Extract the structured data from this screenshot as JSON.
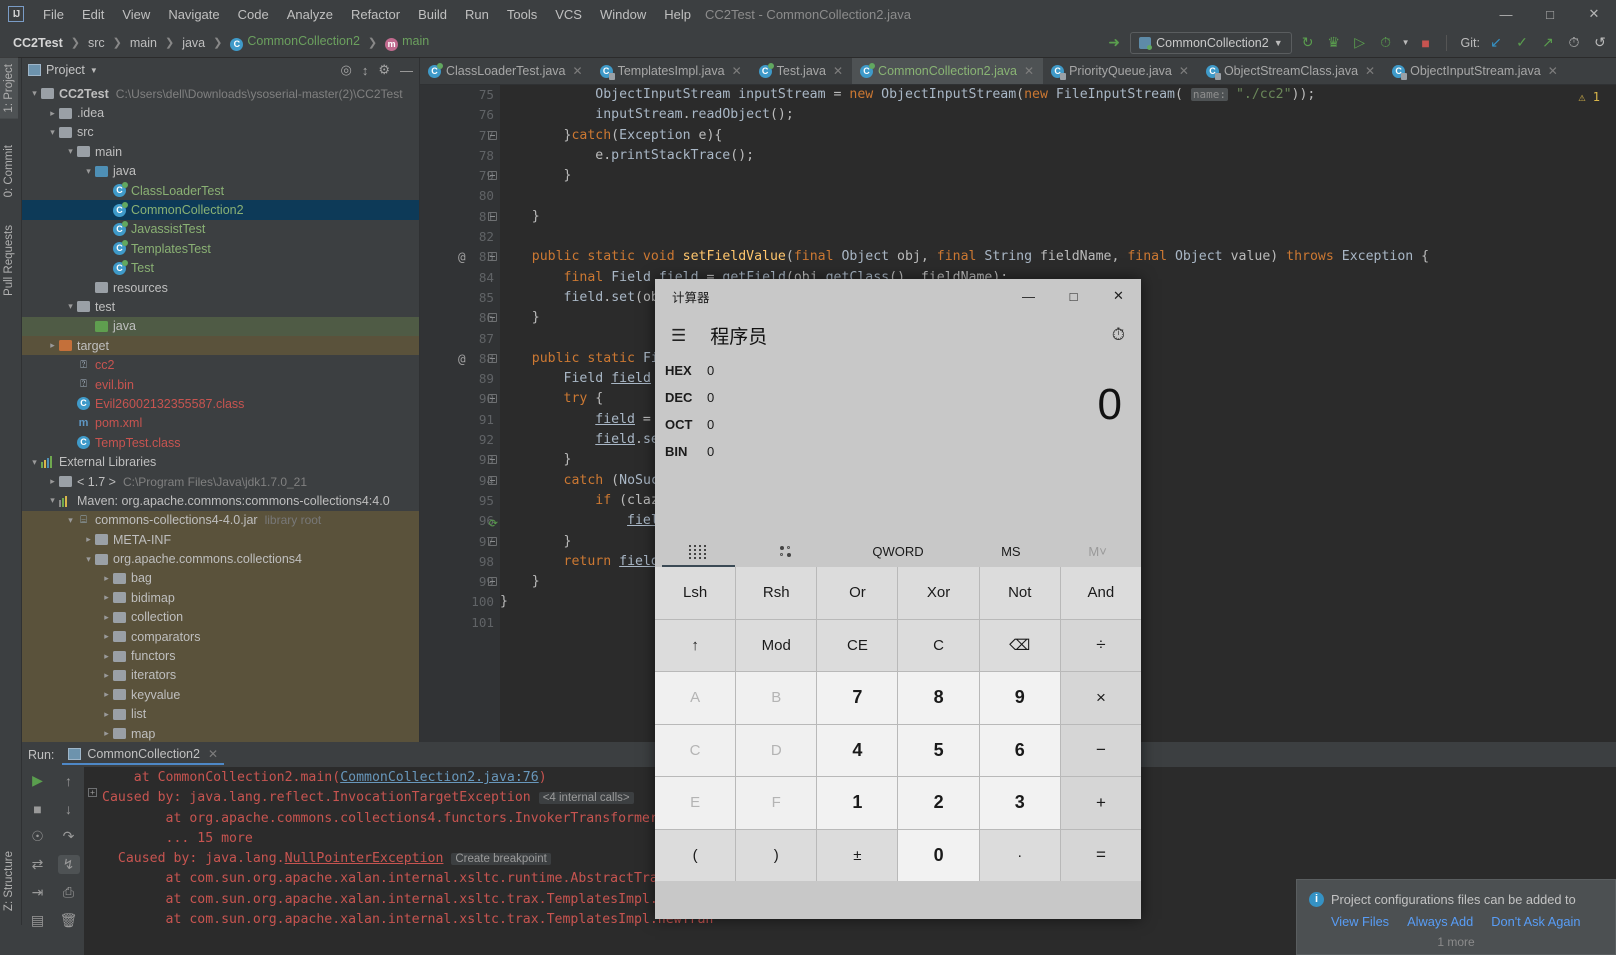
{
  "window": {
    "title": "CC2Test - CommonCollection2.java",
    "controls": [
      "—",
      "□",
      "✕"
    ]
  },
  "menubar": {
    "logo": "IJ",
    "items": [
      "File",
      "Edit",
      "View",
      "Navigate",
      "Code",
      "Analyze",
      "Refactor",
      "Build",
      "Run",
      "Tools",
      "VCS",
      "Window",
      "Help"
    ]
  },
  "breadcrumb": {
    "items": [
      {
        "label": "CC2Test",
        "style": "bold"
      },
      {
        "label": "src",
        "style": "plain"
      },
      {
        "label": "main",
        "style": "plain"
      },
      {
        "label": "java",
        "style": "plain"
      },
      {
        "label": "CommonCollection2",
        "style": "class"
      },
      {
        "label": "main",
        "style": "method"
      }
    ]
  },
  "toolbar": {
    "back_arrow_icon": "back-arrow-icon",
    "run_config": "CommonCollection2",
    "icons": [
      "rerun-icon",
      "debug-icon",
      "run-with-coverage-icon",
      "profiler-icon",
      "stop-icon"
    ],
    "git_label": "Git:",
    "git_icons": [
      "update-project-icon",
      "commit-icon",
      "push-icon",
      "history-icon",
      "rollback-icon"
    ]
  },
  "left_strip": {
    "tabs": [
      "1: Project",
      "0: Commit",
      "Pull Requests"
    ],
    "bottom_tabs": [
      "Z: Structure"
    ]
  },
  "project_panel": {
    "title": "Project",
    "actions": [
      "locate-icon",
      "collapse-all-icon",
      "settings-icon",
      "hide-icon"
    ],
    "tree": [
      {
        "depth": 0,
        "arrow": "down",
        "icon": "module-folder",
        "label": "CC2Test",
        "style": "bold",
        "path": "C:\\Users\\dell\\Downloads\\ysoserial-master(2)\\CC2Test"
      },
      {
        "depth": 1,
        "arrow": "right",
        "icon": "folder-grey",
        "label": ".idea"
      },
      {
        "depth": 1,
        "arrow": "down",
        "icon": "folder-grey",
        "label": "src"
      },
      {
        "depth": 2,
        "arrow": "down",
        "icon": "folder-grey",
        "label": "main"
      },
      {
        "depth": 3,
        "arrow": "down",
        "icon": "folder-blue",
        "label": "java"
      },
      {
        "depth": 4,
        "arrow": "none",
        "icon": "class",
        "label": "ClassLoaderTest",
        "style": "green"
      },
      {
        "depth": 4,
        "arrow": "none",
        "icon": "class",
        "label": "CommonCollection2",
        "style": "green",
        "selected": true
      },
      {
        "depth": 4,
        "arrow": "none",
        "icon": "class",
        "label": "JavassistTest",
        "style": "green"
      },
      {
        "depth": 4,
        "arrow": "none",
        "icon": "class",
        "label": "TemplatesTest",
        "style": "green"
      },
      {
        "depth": 4,
        "arrow": "none",
        "icon": "class",
        "label": "Test",
        "style": "green"
      },
      {
        "depth": 3,
        "arrow": "none",
        "icon": "folder-resources",
        "label": "resources"
      },
      {
        "depth": 2,
        "arrow": "down",
        "icon": "folder-grey",
        "label": "test"
      },
      {
        "depth": 3,
        "arrow": "none",
        "icon": "folder-green",
        "label": "java",
        "highlight": "green"
      },
      {
        "depth": 1,
        "arrow": "right",
        "icon": "folder-orange",
        "label": "target",
        "highlight": "olive"
      },
      {
        "depth": 2,
        "arrow": "none",
        "icon": "file-unknown",
        "label": "cc2",
        "style": "red"
      },
      {
        "depth": 2,
        "arrow": "none",
        "icon": "file-unknown",
        "label": "evil.bin",
        "style": "red"
      },
      {
        "depth": 2,
        "arrow": "none",
        "icon": "class-plain",
        "label": "Evil26002132355587.class",
        "style": "red"
      },
      {
        "depth": 2,
        "arrow": "none",
        "icon": "maven-file",
        "label": "pom.xml",
        "style": "red"
      },
      {
        "depth": 2,
        "arrow": "none",
        "icon": "class-plain",
        "label": "TempTest.class",
        "style": "red"
      },
      {
        "depth": 0,
        "arrow": "down",
        "icon": "libraries",
        "label": "External Libraries"
      },
      {
        "depth": 1,
        "arrow": "right",
        "icon": "jdk",
        "label": "< 1.7 >",
        "path": "C:\\Program Files\\Java\\jdk1.7.0_21"
      },
      {
        "depth": 1,
        "arrow": "down",
        "icon": "maven-lib",
        "label": "Maven: org.apache.commons:commons-collections4:4.0"
      },
      {
        "depth": 2,
        "arrow": "down",
        "icon": "jar",
        "label": "commons-collections4-4.0.jar",
        "hint": "library root",
        "highlight": "olive"
      },
      {
        "depth": 3,
        "arrow": "right",
        "icon": "folder-grey",
        "label": "META-INF",
        "highlight": "olive"
      },
      {
        "depth": 3,
        "arrow": "down",
        "icon": "folder-grey",
        "label": "org.apache.commons.collections4",
        "highlight": "olive"
      },
      {
        "depth": 4,
        "arrow": "right",
        "icon": "folder-grey",
        "label": "bag",
        "highlight": "olive"
      },
      {
        "depth": 4,
        "arrow": "right",
        "icon": "folder-grey",
        "label": "bidimap",
        "highlight": "olive"
      },
      {
        "depth": 4,
        "arrow": "right",
        "icon": "folder-grey",
        "label": "collection",
        "highlight": "olive"
      },
      {
        "depth": 4,
        "arrow": "right",
        "icon": "folder-grey",
        "label": "comparators",
        "highlight": "olive"
      },
      {
        "depth": 4,
        "arrow": "right",
        "icon": "folder-grey",
        "label": "functors",
        "highlight": "olive"
      },
      {
        "depth": 4,
        "arrow": "right",
        "icon": "folder-grey",
        "label": "iterators",
        "highlight": "olive"
      },
      {
        "depth": 4,
        "arrow": "right",
        "icon": "folder-grey",
        "label": "keyvalue",
        "highlight": "olive"
      },
      {
        "depth": 4,
        "arrow": "right",
        "icon": "folder-grey",
        "label": "list",
        "highlight": "olive"
      },
      {
        "depth": 4,
        "arrow": "right",
        "icon": "folder-grey",
        "label": "map",
        "highlight": "olive"
      }
    ]
  },
  "editor_tabs": [
    {
      "label": "ClassLoaderTest.java",
      "icon": "java-class-icon",
      "active": false
    },
    {
      "label": "TemplatesImpl.java",
      "icon": "java-class-locked-icon",
      "active": false
    },
    {
      "label": "Test.java",
      "icon": "java-class-icon",
      "active": false
    },
    {
      "label": "CommonCollection2.java",
      "icon": "java-class-icon",
      "active": true
    },
    {
      "label": "PriorityQueue.java",
      "icon": "java-class-locked-icon",
      "active": false
    },
    {
      "label": "ObjectStreamClass.java",
      "icon": "java-class-locked-icon",
      "active": false
    },
    {
      "label": "ObjectInputStream.java",
      "icon": "java-class-locked-icon",
      "active": false
    }
  ],
  "editor": {
    "warning_count": "1",
    "lines": [
      {
        "num": "75",
        "marker": "",
        "fold": "",
        "code_html": "            <span class=\"id\">ObjectInputStream</span> <span class=\"id\">inputStream</span> = <span class=\"k\">new</span> <span class=\"id\">ObjectInputStream</span>(<span class=\"k\">new</span> <span class=\"id\">FileInputStream</span>( <span class=\"param\">name:</span> <span class=\"s\">\"./cc2\"</span>));"
      },
      {
        "num": "76",
        "marker": "",
        "fold": "",
        "code_html": "            <span class=\"id\">inputStream</span>.<span class=\"id\">readObject</span>();"
      },
      {
        "num": "77",
        "marker": "",
        "fold": "minus",
        "code_html": "        }<span class=\"k\">catch</span>(<span class=\"id\">Exception</span> e){"
      },
      {
        "num": "78",
        "marker": "",
        "fold": "",
        "code_html": "            e.<span class=\"id\">printStackTrace</span>();"
      },
      {
        "num": "79",
        "marker": "",
        "fold": "end",
        "code_html": "        }"
      },
      {
        "num": "80",
        "marker": "",
        "fold": "",
        "code_html": ""
      },
      {
        "num": "81",
        "marker": "",
        "fold": "end",
        "code_html": "    }"
      },
      {
        "num": "82",
        "marker": "",
        "fold": "",
        "code_html": ""
      },
      {
        "num": "83",
        "marker": "@",
        "fold": "minus",
        "code_html": "    <span class=\"k\">public static void</span> <span class=\"f\">setFieldValue</span>(<span class=\"k\">final</span> <span class=\"id\">Object</span> obj, <span class=\"k\">final</span> <span class=\"id\">String</span> fieldName, <span class=\"k\">final</span> <span class=\"id\">Object</span> value) <span class=\"k\">throws</span> <span class=\"id\">Exception</span> {"
      },
      {
        "num": "84",
        "marker": "",
        "fold": "",
        "code_html": "        <span class=\"k\">final</span> <span class=\"id\">Field</span> <span class=\"u\">field</span> = <span class=\"id\">getField</span>(obj.<span class=\"id\">getClass</span>(), fieldName);"
      },
      {
        "num": "85",
        "marker": "",
        "fold": "",
        "code_html": "        <span class=\"id\">field</span>.<span class=\"id\">set</span>(obj, value);"
      },
      {
        "num": "86",
        "marker": "",
        "fold": "end",
        "code_html": "    }"
      },
      {
        "num": "87",
        "marker": "",
        "fold": "",
        "code_html": ""
      },
      {
        "num": "88",
        "marker": "@",
        "fold": "minus",
        "code_html": "    <span class=\"k\">public static</span> <span class=\"id\">Field</span> <span class=\"f\">getField</span>("
      },
      {
        "num": "89",
        "marker": "",
        "fold": "",
        "code_html": "        <span class=\"id\">Field</span> <span class=\"u\">field</span> = "
      },
      {
        "num": "90",
        "marker": "",
        "fold": "minus",
        "code_html": "        <span class=\"k\">try</span> {"
      },
      {
        "num": "91",
        "marker": "",
        "fold": "",
        "code_html": "            <span class=\"u\">field</span> = c"
      },
      {
        "num": "92",
        "marker": "",
        "fold": "",
        "code_html": "            <span class=\"u\">field</span>.<span class=\"id\">set</span>"
      },
      {
        "num": "93",
        "marker": "",
        "fold": "end",
        "code_html": "        }"
      },
      {
        "num": "94",
        "marker": "",
        "fold": "minus",
        "code_html": "        <span class=\"k\">catch</span> (<span class=\"id\">NoSuch</span>"
      },
      {
        "num": "95",
        "marker": "",
        "fold": "",
        "code_html": "            <span class=\"k\">if</span> (clazz"
      },
      {
        "num": "96",
        "marker": "run",
        "fold": "",
        "code_html": "                <span class=\"u\">field</span>"
      },
      {
        "num": "97",
        "marker": "",
        "fold": "end",
        "code_html": "        }"
      },
      {
        "num": "98",
        "marker": "",
        "fold": "",
        "code_html": "        <span class=\"k\">return</span> <span class=\"u\">field</span>;"
      },
      {
        "num": "99",
        "marker": "",
        "fold": "end",
        "code_html": "    }"
      },
      {
        "num": "100",
        "marker": "",
        "fold": "",
        "code_html": "}"
      },
      {
        "num": "101",
        "marker": "",
        "fold": "",
        "code_html": ""
      }
    ]
  },
  "run_panel": {
    "label": "Run:",
    "tab": "CommonCollection2",
    "left_icons": [
      "run-icon",
      "stop-icon",
      "screenshot-icon",
      "rerun-failed-icon",
      "export-icon",
      "layout-icon"
    ],
    "right_icons": [
      "scroll-up-icon",
      "scroll-down-icon",
      "soft-wrap-icon",
      "scroll-to-end-icon",
      "print-icon",
      "trash-icon"
    ],
    "console_lines": [
      {
        "html": "    at CommonCollection2.main(<span class=\"lnk\">CommonCollection2.java:76</span>)",
        "expander": false
      },
      {
        "html": "Caused by: java.lang.reflect.InvocationTargetException <span class=\"chip\">&lt;4 internal calls&gt;</span>",
        "expander": true
      },
      {
        "html": "        at org.apache.commons.collections4.functors.InvokerTransformer.transf",
        "expander": false
      },
      {
        "html": "        ... 15 more",
        "expander": false
      },
      {
        "html": "  Caused by: java.lang.<span class=\"npe\">NullPointerException</span> <span class=\"chip\">Create breakpoint</span>",
        "expander": false
      },
      {
        "html": "        at com.sun.org.apache.xalan.internal.xsltc.runtime.AbstractTranslet.p",
        "expander": false
      },
      {
        "html": "        at com.sun.org.apache.xalan.internal.xsltc.trax.TemplatesImpl.getTran",
        "expander": false
      },
      {
        "html": "        at com.sun.org.apache.xalan.internal.xsltc.trax.TemplatesImpl.newTran",
        "expander": false
      }
    ]
  },
  "notification": {
    "icon": "info-icon",
    "message": "Project configurations files can be added to",
    "actions": [
      "View Files",
      "Always Add",
      "Don't Ask Again"
    ],
    "more": "1 more"
  },
  "calculator": {
    "title": "计算器",
    "controls": [
      "—",
      "□",
      "✕"
    ],
    "menu_icon": "hamburger-icon",
    "mode": "程序员",
    "history_icon": "history-icon",
    "display_value": "0",
    "bases": [
      {
        "name": "HEX",
        "value": "0"
      },
      {
        "name": "DEC",
        "value": "0"
      },
      {
        "name": "OCT",
        "value": "0"
      },
      {
        "name": "BIN",
        "value": "0"
      }
    ],
    "options": [
      {
        "label": "",
        "icon": "keypad-icon",
        "selected": true
      },
      {
        "label": "",
        "icon": "bit-toggle-icon",
        "selected": false
      },
      {
        "label": "QWORD",
        "icon": "",
        "selected": false
      },
      {
        "label": "MS",
        "icon": "",
        "selected": false
      },
      {
        "label": "M˅",
        "icon": "",
        "selected": false,
        "dim": true
      }
    ],
    "keys": [
      {
        "label": "Lsh",
        "type": "func"
      },
      {
        "label": "Rsh",
        "type": "func"
      },
      {
        "label": "Or",
        "type": "func"
      },
      {
        "label": "Xor",
        "type": "func"
      },
      {
        "label": "Not",
        "type": "func"
      },
      {
        "label": "And",
        "type": "func"
      },
      {
        "label": "↑",
        "type": "func"
      },
      {
        "label": "Mod",
        "type": "func"
      },
      {
        "label": "CE",
        "type": "func"
      },
      {
        "label": "C",
        "type": "func"
      },
      {
        "label": "⌫",
        "type": "func"
      },
      {
        "label": "÷",
        "type": "op"
      },
      {
        "label": "A",
        "type": "dim"
      },
      {
        "label": "B",
        "type": "dim"
      },
      {
        "label": "7",
        "type": "num"
      },
      {
        "label": "8",
        "type": "num"
      },
      {
        "label": "9",
        "type": "num"
      },
      {
        "label": "×",
        "type": "op"
      },
      {
        "label": "C",
        "type": "dim"
      },
      {
        "label": "D",
        "type": "dim"
      },
      {
        "label": "4",
        "type": "num"
      },
      {
        "label": "5",
        "type": "num"
      },
      {
        "label": "6",
        "type": "num"
      },
      {
        "label": "−",
        "type": "op"
      },
      {
        "label": "E",
        "type": "dim"
      },
      {
        "label": "F",
        "type": "dim"
      },
      {
        "label": "1",
        "type": "num"
      },
      {
        "label": "2",
        "type": "num"
      },
      {
        "label": "3",
        "type": "num"
      },
      {
        "label": "+",
        "type": "op"
      },
      {
        "label": "(",
        "type": "func"
      },
      {
        "label": ")",
        "type": "func"
      },
      {
        "label": "±",
        "type": "func"
      },
      {
        "label": "0",
        "type": "num"
      },
      {
        "label": "·",
        "type": "func"
      },
      {
        "label": "=",
        "type": "op"
      }
    ]
  }
}
